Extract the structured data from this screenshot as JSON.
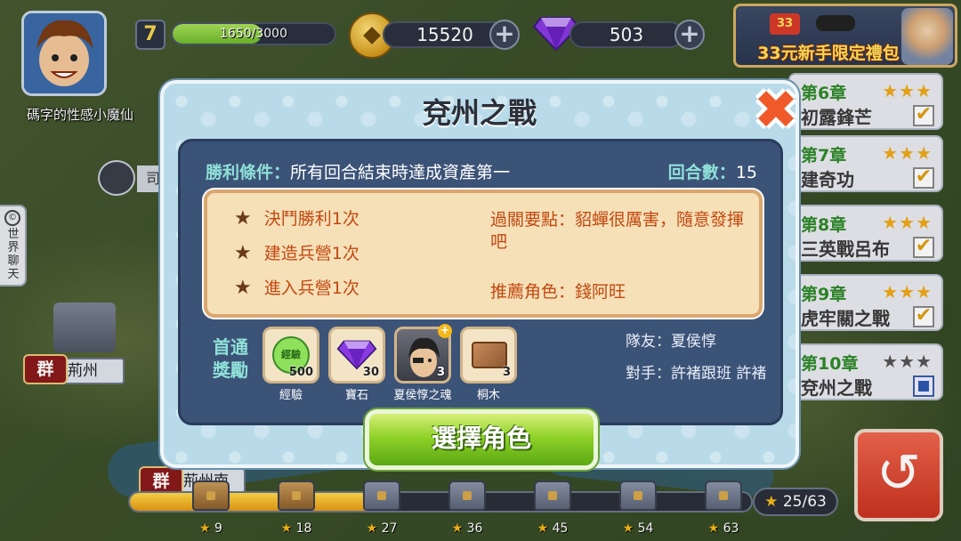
{
  "player": {
    "name": "碼字的性感小魔仙",
    "level": "7",
    "exp_text": "1650/3000",
    "exp_fraction": 0.55
  },
  "resources": {
    "coins": "15520",
    "gems": "503"
  },
  "promo": {
    "text": "33元新手限定禮包",
    "badge": "33"
  },
  "chapters": [
    {
      "num": "第6章",
      "title": "初露鋒芒",
      "stars": "★★★",
      "done": true
    },
    {
      "num": "第7章",
      "title": "建奇功",
      "stars": "★★★",
      "done": true
    },
    {
      "num": "第8章",
      "title": "三英戰呂布",
      "stars": "★★★",
      "done": true
    },
    {
      "num": "第9章",
      "title": "虎牢關之戰",
      "stars": "★★★",
      "done": true
    },
    {
      "num": "第10章",
      "title": "兗州之戰",
      "stars": "★★★",
      "done": false
    }
  ],
  "sidebar": {
    "world_chat": "世界聊天",
    "world_chat_icon": "©"
  },
  "map": {
    "city_badge": "群",
    "city_1": "荊州",
    "city_2": "荊州南",
    "city_top": "司"
  },
  "progress": {
    "stars": "25/63",
    "fraction": 0.39,
    "milestones": [
      "9",
      "18",
      "27",
      "36",
      "45",
      "54",
      "63"
    ]
  },
  "modal": {
    "title": "兗州之戰",
    "victory_label": "勝利條件：",
    "victory_text": "所有回合結束時達成資產第一",
    "turns_label": "回合數：",
    "turns_value": "15",
    "objectives": [
      "決鬥勝利1次",
      "建造兵營1次",
      "進入兵營1次"
    ],
    "tips": "過關要點：貂蟬很厲害，隨意發揮吧",
    "recommend": "推薦角色：錢阿旺",
    "reward_label": "首通獎勵",
    "rewards": [
      {
        "name": "經驗",
        "qty": "500",
        "icon": "exp-icon",
        "icon_text": "經驗"
      },
      {
        "name": "寶石",
        "qty": "30",
        "icon": "gem-icon"
      },
      {
        "name": "夏侯惇之魂",
        "qty": "3",
        "icon": "hero-soul-icon"
      },
      {
        "name": "桐木",
        "qty": "3",
        "icon": "wood-icon"
      }
    ],
    "teammate": "隊友：夏侯惇",
    "opponent": "對手：許褚跟班 許褚",
    "select_button": "選擇角色"
  },
  "colors": {
    "accent_green": "#8fd228",
    "objective_text": "#c24810",
    "panel_blue": "#3c5378"
  }
}
